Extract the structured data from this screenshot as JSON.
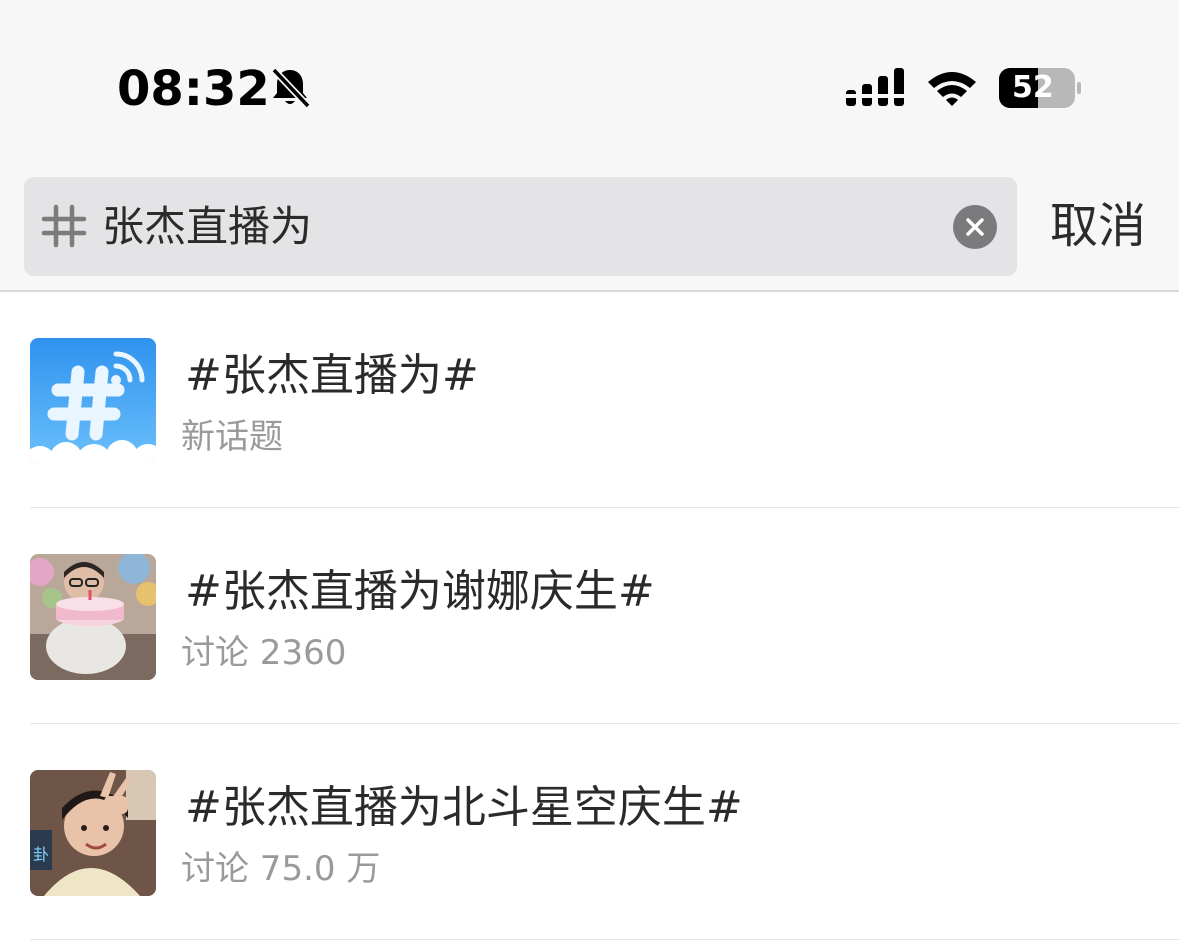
{
  "status_bar": {
    "time": "08:32",
    "battery_level": "52",
    "icons": [
      "bell-slash-icon",
      "cellular-signal-icon",
      "wifi-icon",
      "battery-icon"
    ]
  },
  "search": {
    "icon": "hashtag-icon",
    "query": "张杰直播为",
    "clear_icon": "clear-icon",
    "cancel_label": "取消"
  },
  "results": [
    {
      "title": "#张杰直播为#",
      "subtitle": "新话题",
      "thumb": "new-topic-icon"
    },
    {
      "title": "#张杰直播为谢娜庆生#",
      "subtitle": "讨论 2360",
      "thumb": "topic-photo"
    },
    {
      "title": "#张杰直播为北斗星空庆生#",
      "subtitle": "讨论 75.0 万",
      "thumb": "topic-photo"
    }
  ],
  "colors": {
    "header_bg": "#f7f7f7",
    "search_bg": "#e4e4e6",
    "subtitle": "#9a9a9a",
    "topic_icon_blue": "#3a9ff0"
  }
}
